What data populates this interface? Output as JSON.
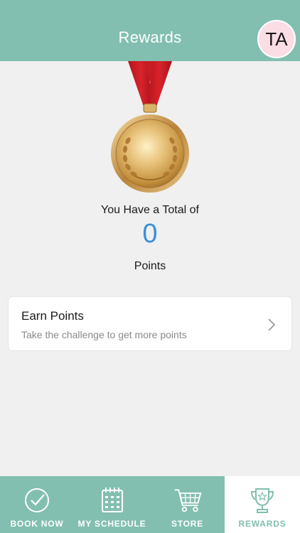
{
  "header": {
    "title": "Rewards",
    "avatar_initials": "TA"
  },
  "summary": {
    "total_label": "You Have a Total of",
    "points_value": "0",
    "points_label": "Points"
  },
  "earn_card": {
    "title": "Earn Points",
    "subtitle": "Take the challenge to get more points"
  },
  "tabs": [
    {
      "label": "BOOK NOW",
      "icon": "checkmark-circle-icon"
    },
    {
      "label": "MY SCHEDULE",
      "icon": "calendar-icon"
    },
    {
      "label": "STORE",
      "icon": "cart-icon"
    },
    {
      "label": "REWARDS",
      "icon": "trophy-icon",
      "active": true
    }
  ],
  "colors": {
    "accent": "#82bfb0",
    "points_blue": "#3b8fd9",
    "avatar_bg": "#fbdde6",
    "background": "#f0f0f0"
  }
}
